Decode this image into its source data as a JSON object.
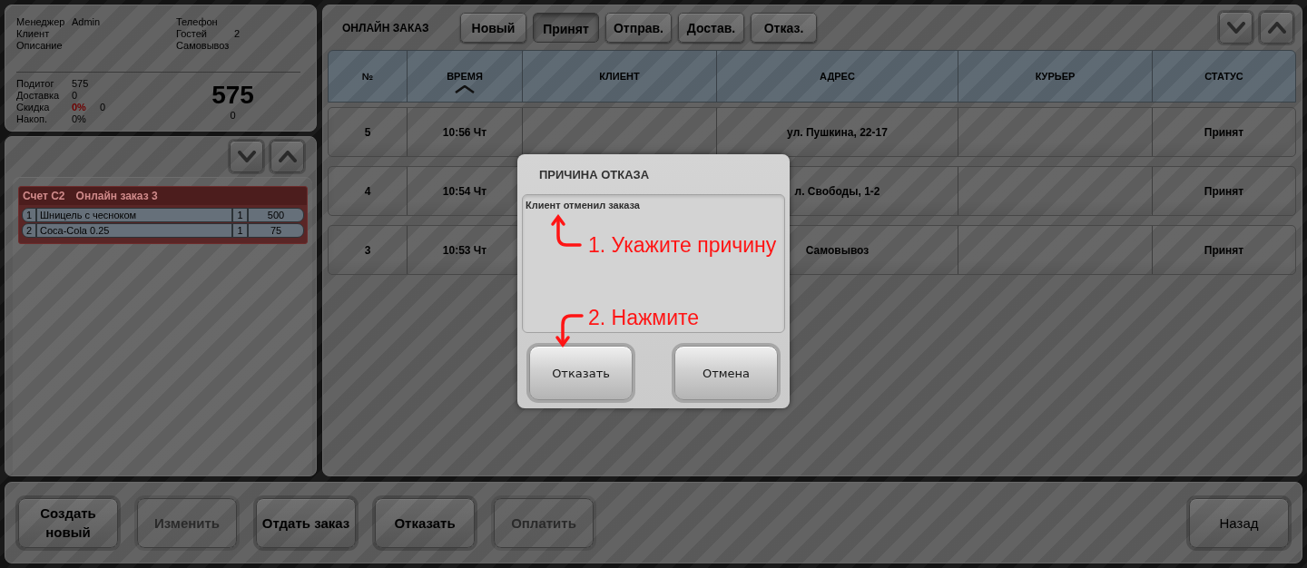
{
  "info_panel": {
    "details_left": [
      {
        "label": "Менеджер",
        "value": "Admin"
      },
      {
        "label": "Клиент"
      },
      {
        "label": "Описание"
      }
    ],
    "details_right": [
      {
        "label": "Телефон"
      },
      {
        "label": "Гостей",
        "value": "2"
      },
      {
        "label": "Самовывоз"
      }
    ],
    "totals": [
      {
        "label": "Подитог",
        "value": "575"
      },
      {
        "label": "Доставка",
        "value": "0"
      },
      {
        "label": "Скидка",
        "value": "0%",
        "color": "#6e0000",
        "amount": "0"
      },
      {
        "label": "Накоп.",
        "value": "0%"
      }
    ],
    "total": "575",
    "total_note": "0"
  },
  "order_panel": {
    "bill": "Счет С2",
    "order": "Онлайн заказ 3",
    "items": [
      {
        "number": "1",
        "name": "Шницель с чесноком",
        "quantity": "1",
        "price": "500"
      },
      {
        "number": "2",
        "name": "Coca-Cola 0.25",
        "quantity": "1",
        "price": "75"
      }
    ]
  },
  "main": {
    "title": "ОНЛАЙН ЗАКАЗ",
    "tabs": [
      {
        "label": "Новый",
        "selected": false
      },
      {
        "label": "Принят",
        "selected": true
      },
      {
        "label": "Отправ.",
        "selected": false
      },
      {
        "label": "Достав.",
        "selected": false
      },
      {
        "label": "Отказ.",
        "selected": false
      }
    ],
    "table": {
      "columns": [
        {
          "label": "№",
          "sorted": false
        },
        {
          "label": "ВРЕМЯ",
          "sorted": true
        },
        {
          "label": "КЛИЕНТ",
          "sorted": false
        },
        {
          "label": "АДРЕС",
          "sorted": false
        },
        {
          "label": "КУРЬЕР",
          "sorted": false
        },
        {
          "label": "СТАТУС",
          "sorted": false
        }
      ],
      "rows": [
        {
          "number": "5",
          "time": "10:56 Чт",
          "address": "ул. Пушкина, 22-17",
          "status": "Принят"
        },
        {
          "number": "4",
          "time": "10:54 Чт",
          "address": "л. Свободы, 1-2",
          "status": "Принят"
        },
        {
          "number": "3",
          "time": "10:53 Чт",
          "address": "Самовывоз",
          "status": "Принят"
        }
      ]
    }
  },
  "dialog": {
    "title": "ПРИЧИНА ОТКАЗА",
    "reason": "Клиент отменил заказа",
    "buttons": [
      {
        "label": "Отказать"
      },
      {
        "label": "Отмена"
      }
    ],
    "annotations": [
      {
        "kind": "up",
        "text": "1. Укажите причину"
      },
      {
        "kind": "down",
        "text": "2. Нажмите"
      }
    ]
  },
  "bottom_bar": {
    "actions": [
      {
        "label": "Создать новый",
        "disabled": false
      },
      {
        "label": "Изменить",
        "disabled": true
      },
      {
        "label": "Отдать заказ",
        "disabled": false
      },
      {
        "label": "Отказать",
        "disabled": false
      },
      {
        "label": "Оплатить",
        "disabled": true
      }
    ],
    "back_button": {
      "label": "Назад"
    }
  }
}
